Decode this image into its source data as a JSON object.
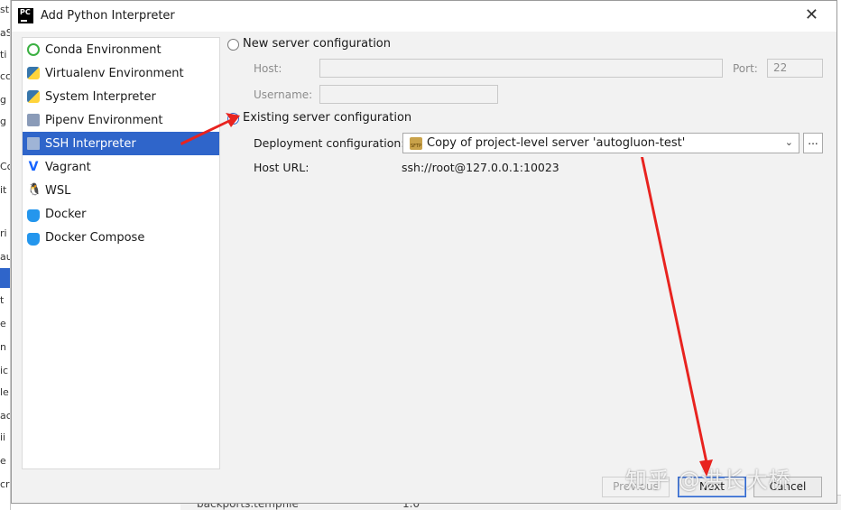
{
  "background": {
    "left_fragments": [
      "st",
      "aS",
      "ti",
      "cc",
      "g",
      "g",
      "Cc",
      "it",
      "ri",
      "au",
      "t",
      "e",
      "n",
      "ic",
      "le",
      "ac",
      "ii",
      "e",
      "cr"
    ],
    "bottom_row": {
      "file": "backports.tempfile",
      "version": "1.0"
    }
  },
  "dialog": {
    "title": "Add Python Interpreter",
    "close_glyph": "✕",
    "logo_text": "PC"
  },
  "sidebar": {
    "items": [
      {
        "label": "Conda Environment",
        "icon": "conda-icon"
      },
      {
        "label": "Virtualenv Environment",
        "icon": "virtualenv-icon"
      },
      {
        "label": "System Interpreter",
        "icon": "python-icon"
      },
      {
        "label": "Pipenv Environment",
        "icon": "pipenv-icon"
      },
      {
        "label": "SSH Interpreter",
        "icon": "ssh-icon",
        "selected": true
      },
      {
        "label": "Vagrant",
        "icon": "vagrant-icon"
      },
      {
        "label": "WSL",
        "icon": "linux-penguin-icon"
      },
      {
        "label": "Docker",
        "icon": "docker-icon"
      },
      {
        "label": "Docker Compose",
        "icon": "docker-compose-icon"
      }
    ]
  },
  "main": {
    "new_server": {
      "label": "New server configuration",
      "host_label": "Host:",
      "host_value": "",
      "port_label": "Port:",
      "port_value": "22",
      "username_label": "Username:",
      "username_value": ""
    },
    "existing_server": {
      "label": "Existing server configuration",
      "deployment_label": "Deployment configuration:",
      "deployment_value": "Copy of project-level server 'autogluon-test'",
      "deployment_icon_text": "SFTP",
      "more_button": "...",
      "host_url_label": "Host URL:",
      "host_url_value": "ssh://root@127.0.0.1:10023"
    }
  },
  "footer": {
    "previous": "Previous",
    "next": "Next",
    "cancel": "Cancel"
  },
  "watermark": "知乎 @洪长大桥",
  "colors": {
    "selection": "#2f65ca",
    "annotation_arrow": "#e8231f"
  }
}
